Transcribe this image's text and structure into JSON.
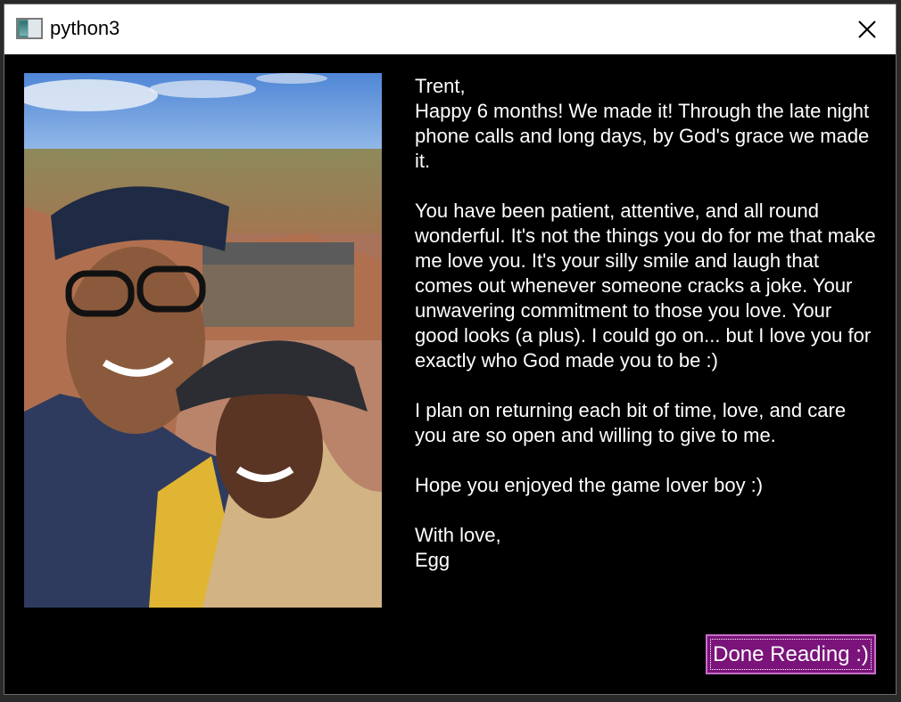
{
  "window": {
    "title": "python3",
    "icon": "python-app-icon",
    "close_icon": "close-icon"
  },
  "photo": {
    "description_icon": "couple-selfie-photo"
  },
  "letter": {
    "greeting": "Trent,",
    "paragraph1": "Happy 6 months! We made it! Through the late night phone calls and long days, by God's grace we made it.",
    "paragraph2": "You have been patient, attentive, and all round wonderful. It's not the things you do for me that make me love you. It's your silly smile and laugh that comes out whenever someone cracks a joke. Your unwavering commitment to those you love. Your good looks (a plus). I could go on... but I love you for exactly who God made you to be :)",
    "paragraph3": "I plan on returning each bit of time, love, and care you are so open and willing to give to me.",
    "paragraph4": "Hope you enjoyed the game lover boy :)",
    "signoff": "With love,",
    "signature": "Egg"
  },
  "done_button": {
    "label": "Done Reading :)",
    "color": "#7a137a"
  }
}
